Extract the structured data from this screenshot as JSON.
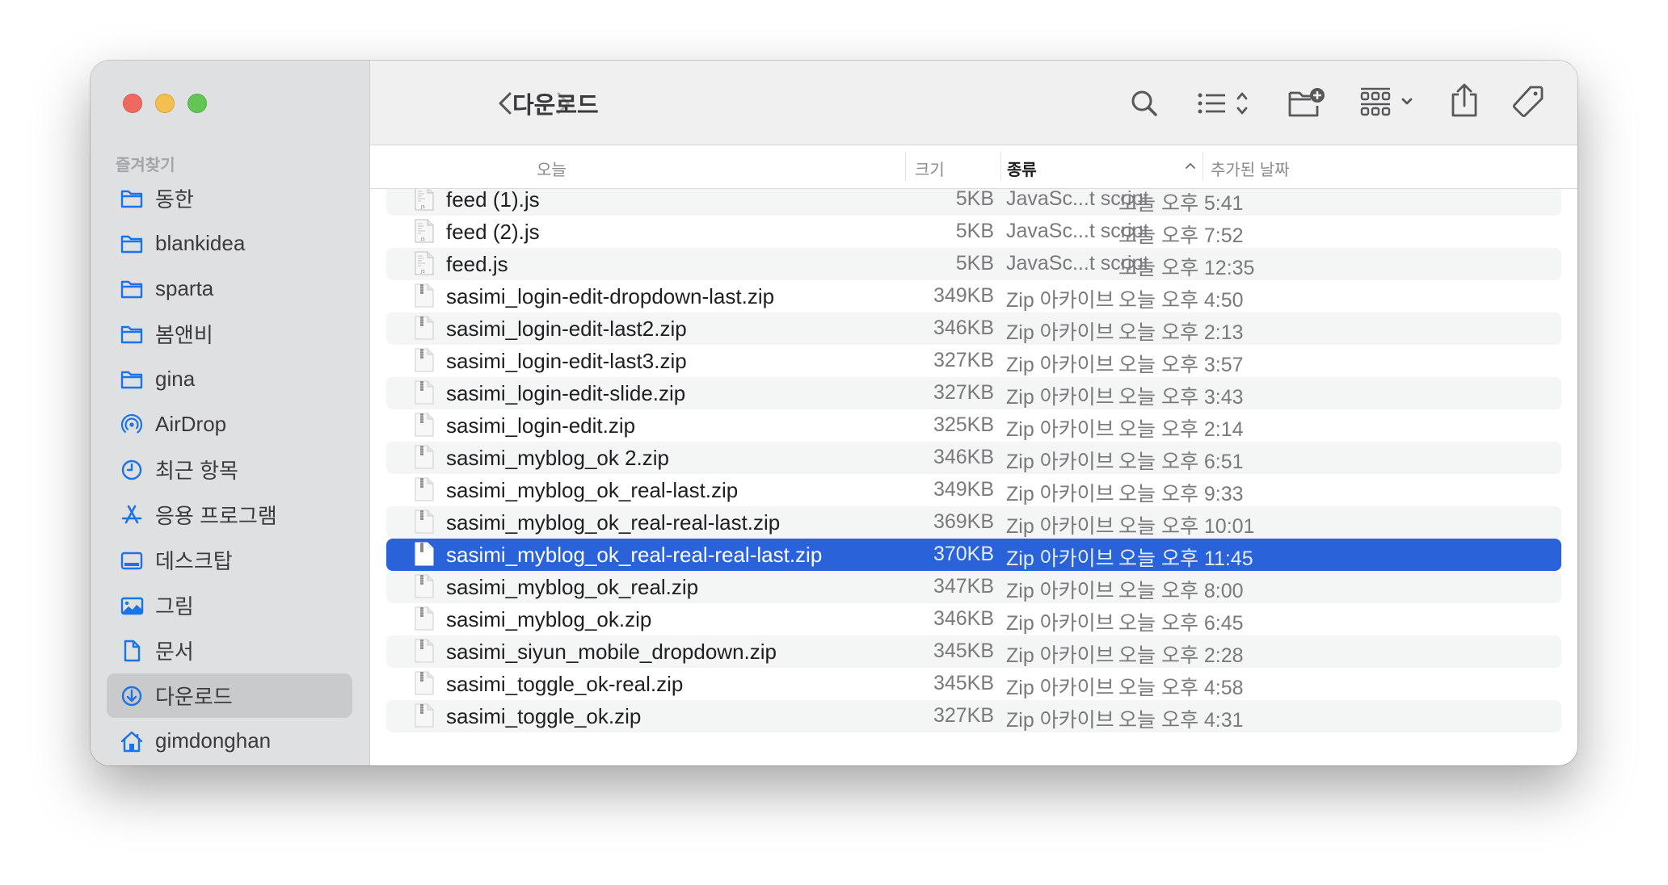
{
  "window": {
    "title": "다운로드",
    "traffic_lights": {
      "close": "#ee6a5f",
      "minimize": "#f5bf4f",
      "zoom": "#62c554"
    }
  },
  "sidebar": {
    "section_label": "즐겨찾기",
    "selected_index": 11,
    "accent_color": "#1a73e8",
    "items": [
      {
        "label": "동한",
        "icon": "folder-icon"
      },
      {
        "label": "blankidea",
        "icon": "folder-icon"
      },
      {
        "label": "sparta",
        "icon": "folder-icon"
      },
      {
        "label": "봄앤비",
        "icon": "folder-icon"
      },
      {
        "label": "gina",
        "icon": "folder-icon"
      },
      {
        "label": "AirDrop",
        "icon": "airdrop-icon"
      },
      {
        "label": "최근 항목",
        "icon": "clock-icon"
      },
      {
        "label": "응용 프로그램",
        "icon": "applications-icon"
      },
      {
        "label": "데스크탑",
        "icon": "desktop-icon"
      },
      {
        "label": "그림",
        "icon": "photo-icon"
      },
      {
        "label": "문서",
        "icon": "document-icon"
      },
      {
        "label": "다운로드",
        "icon": "download-icon"
      },
      {
        "label": "gimdonghan",
        "icon": "home-icon"
      }
    ]
  },
  "toolbar": {
    "back": "back-chevron-icon",
    "forward": "forward-chevron-icon",
    "buttons": [
      "search-icon",
      "list-view-icon",
      "new-folder-icon",
      "group-icon",
      "share-icon",
      "tag-icon",
      "more-icon"
    ]
  },
  "columns": {
    "name": "오늘",
    "size": "크기",
    "kind": "종류",
    "date_added": "추가된 날짜",
    "sorted_by": "kind",
    "sort_direction": "ascending"
  },
  "files": [
    {
      "name": "feed (1).js",
      "size": "5KB",
      "kind": "JavaSc...t script",
      "date": "오늘 오후 5:41",
      "type": "js"
    },
    {
      "name": "feed (2).js",
      "size": "5KB",
      "kind": "JavaSc...t script",
      "date": "오늘 오후 7:52",
      "type": "js"
    },
    {
      "name": "feed.js",
      "size": "5KB",
      "kind": "JavaSc...t script",
      "date": "오늘 오후 12:35",
      "type": "js"
    },
    {
      "name": "sasimi_login-edit-dropdown-last.zip",
      "size": "349KB",
      "kind": "Zip 아카이브",
      "date": "오늘 오후 4:50",
      "type": "zip"
    },
    {
      "name": "sasimi_login-edit-last2.zip",
      "size": "346KB",
      "kind": "Zip 아카이브",
      "date": "오늘 오후 2:13",
      "type": "zip"
    },
    {
      "name": "sasimi_login-edit-last3.zip",
      "size": "327KB",
      "kind": "Zip 아카이브",
      "date": "오늘 오후 3:57",
      "type": "zip"
    },
    {
      "name": "sasimi_login-edit-slide.zip",
      "size": "327KB",
      "kind": "Zip 아카이브",
      "date": "오늘 오후 3:43",
      "type": "zip"
    },
    {
      "name": "sasimi_login-edit.zip",
      "size": "325KB",
      "kind": "Zip 아카이브",
      "date": "오늘 오후 2:14",
      "type": "zip"
    },
    {
      "name": "sasimi_myblog_ok 2.zip",
      "size": "346KB",
      "kind": "Zip 아카이브",
      "date": "오늘 오후 6:51",
      "type": "zip"
    },
    {
      "name": "sasimi_myblog_ok_real-last.zip",
      "size": "349KB",
      "kind": "Zip 아카이브",
      "date": "오늘 오후 9:33",
      "type": "zip"
    },
    {
      "name": "sasimi_myblog_ok_real-real-last.zip",
      "size": "369KB",
      "kind": "Zip 아카이브",
      "date": "오늘 오후 10:01",
      "type": "zip"
    },
    {
      "name": "sasimi_myblog_ok_real-real-real-last.zip",
      "size": "370KB",
      "kind": "Zip 아카이브",
      "date": "오늘 오후 11:45",
      "type": "zip",
      "selected": true
    },
    {
      "name": "sasimi_myblog_ok_real.zip",
      "size": "347KB",
      "kind": "Zip 아카이브",
      "date": "오늘 오후 8:00",
      "type": "zip"
    },
    {
      "name": "sasimi_myblog_ok.zip",
      "size": "346KB",
      "kind": "Zip 아카이브",
      "date": "오늘 오후 6:45",
      "type": "zip"
    },
    {
      "name": "sasimi_siyun_mobile_dropdown.zip",
      "size": "345KB",
      "kind": "Zip 아카이브",
      "date": "오늘 오후 2:28",
      "type": "zip"
    },
    {
      "name": "sasimi_toggle_ok-real.zip",
      "size": "345KB",
      "kind": "Zip 아카이브",
      "date": "오늘 오후 4:58",
      "type": "zip"
    },
    {
      "name": "sasimi_toggle_ok.zip",
      "size": "327KB",
      "kind": "Zip 아카이브",
      "date": "오늘 오후 4:31",
      "type": "zip"
    }
  ],
  "colors": {
    "selection": "#2962d9",
    "alt_row": "#f4f5f5",
    "sidebar_bg": "#dfe0e2",
    "sidebar_selected": "#c9cacc",
    "toolbar_bg": "#f0f0f1"
  }
}
